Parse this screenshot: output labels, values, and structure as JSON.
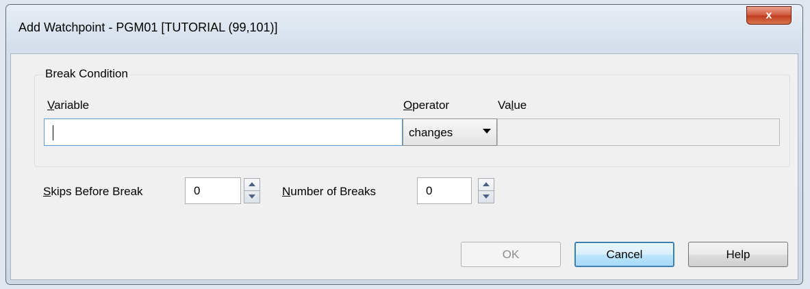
{
  "window": {
    "title": "Add Watchpoint - PGM01 [TUTORIAL (99,101)]",
    "close_icon": "close-icon",
    "close_glyph": "x"
  },
  "break_condition": {
    "group_label": "Break Condition",
    "variable_label_accel": "V",
    "variable_label_rest": "ariable",
    "variable_value": "",
    "operator_label_accel": "O",
    "operator_label_rest": "perator",
    "operator_value": "changes",
    "value_label_pre": "Va",
    "value_label_accel": "l",
    "value_label_post": "ue",
    "value_value": ""
  },
  "skips": {
    "label_accel": "S",
    "label_rest": "kips Before Break",
    "value": "0"
  },
  "breaks": {
    "label_accel": "N",
    "label_rest": "umber of Breaks",
    "value": "0"
  },
  "buttons": {
    "ok": "OK",
    "cancel": "Cancel",
    "help": "Help"
  },
  "colors": {
    "default_button_border": "#3c7fb1",
    "close_button": "#c03b1f"
  }
}
